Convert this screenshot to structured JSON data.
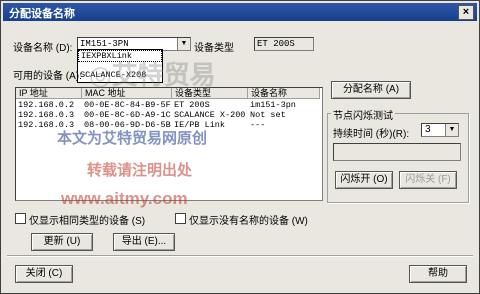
{
  "window": {
    "title": "分配设备名称",
    "close_glyph": "×"
  },
  "device_name": {
    "label": "设备名称 (D):",
    "value": "IM151-3PN",
    "options": [
      "IEXPBXLink",
      "SCALANCE-X208"
    ]
  },
  "device_type": {
    "label": "设备类型",
    "value": "ET 200S"
  },
  "available_devices_label": "可用的设备 (A):",
  "table": {
    "columns": [
      "IP 地址",
      "MAC 地址",
      "设备类型",
      "设备名称"
    ],
    "rows": [
      [
        "192.168.0.2",
        "00-0E-8C-84-B9-5F",
        "ET 200S",
        "im151-3pn"
      ],
      [
        "192.168.0.3",
        "00-0E-8C-6D-A9-1C",
        "SCALANCE X-200",
        "Not set"
      ],
      [
        "192.168.0.3",
        "08-00-06-9D-D6-5B",
        "IE/PB Link",
        "---"
      ]
    ]
  },
  "assign_button": "分配名称 (A)",
  "blink_group": {
    "title": "节点闪烁测试",
    "duration_label": "持续时间 (秒)(R):",
    "duration_value": "3",
    "blink_on": "闪烁开 (O)",
    "blink_off": "闪烁关 (F)"
  },
  "checkbox_same_type": "仅显示相同类型的设备 (S)",
  "checkbox_no_name": "仅显示没有名称的设备 (W)",
  "update_button": "更新 (U)",
  "export_button": "导出 (E)...",
  "close_button": "关闭 (C)",
  "help_button": "帮助",
  "watermark": {
    "line1": "本文为艾特贸易网原创",
    "line2": "转载请注明出处",
    "line3": "www.aitmy.com"
  }
}
